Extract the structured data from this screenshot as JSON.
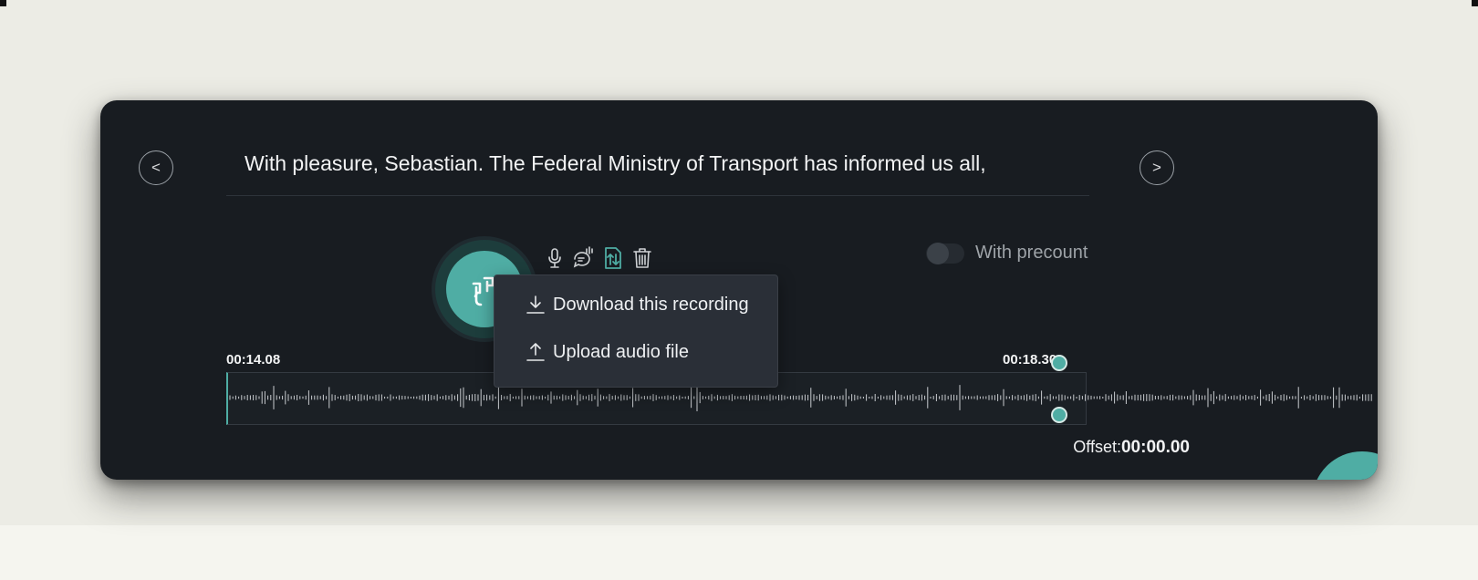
{
  "nav": {
    "prev_label": "<",
    "next_label": ">"
  },
  "sentence": "With pleasure, Sebastian. The Federal Ministry of Transport has informed us all,",
  "toolbar": {
    "tools": [
      {
        "name": "microphone-icon"
      },
      {
        "name": "speech-bubble-icon"
      },
      {
        "name": "import-export-icon"
      },
      {
        "name": "trash-icon"
      }
    ]
  },
  "precount": {
    "label": "With precount",
    "enabled": false
  },
  "menu": {
    "items": [
      {
        "label": "Download this recording",
        "icon": "download-icon"
      },
      {
        "label": "Upload audio file",
        "icon": "upload-icon"
      }
    ]
  },
  "waveform": {
    "start_time": "00:14.08",
    "end_time": "00:18.30"
  },
  "offset": {
    "label": "Offset:",
    "value": "00:00.00"
  },
  "colors": {
    "accent": "#4fada4",
    "panel": "#181c21",
    "background": "#ecece5"
  }
}
